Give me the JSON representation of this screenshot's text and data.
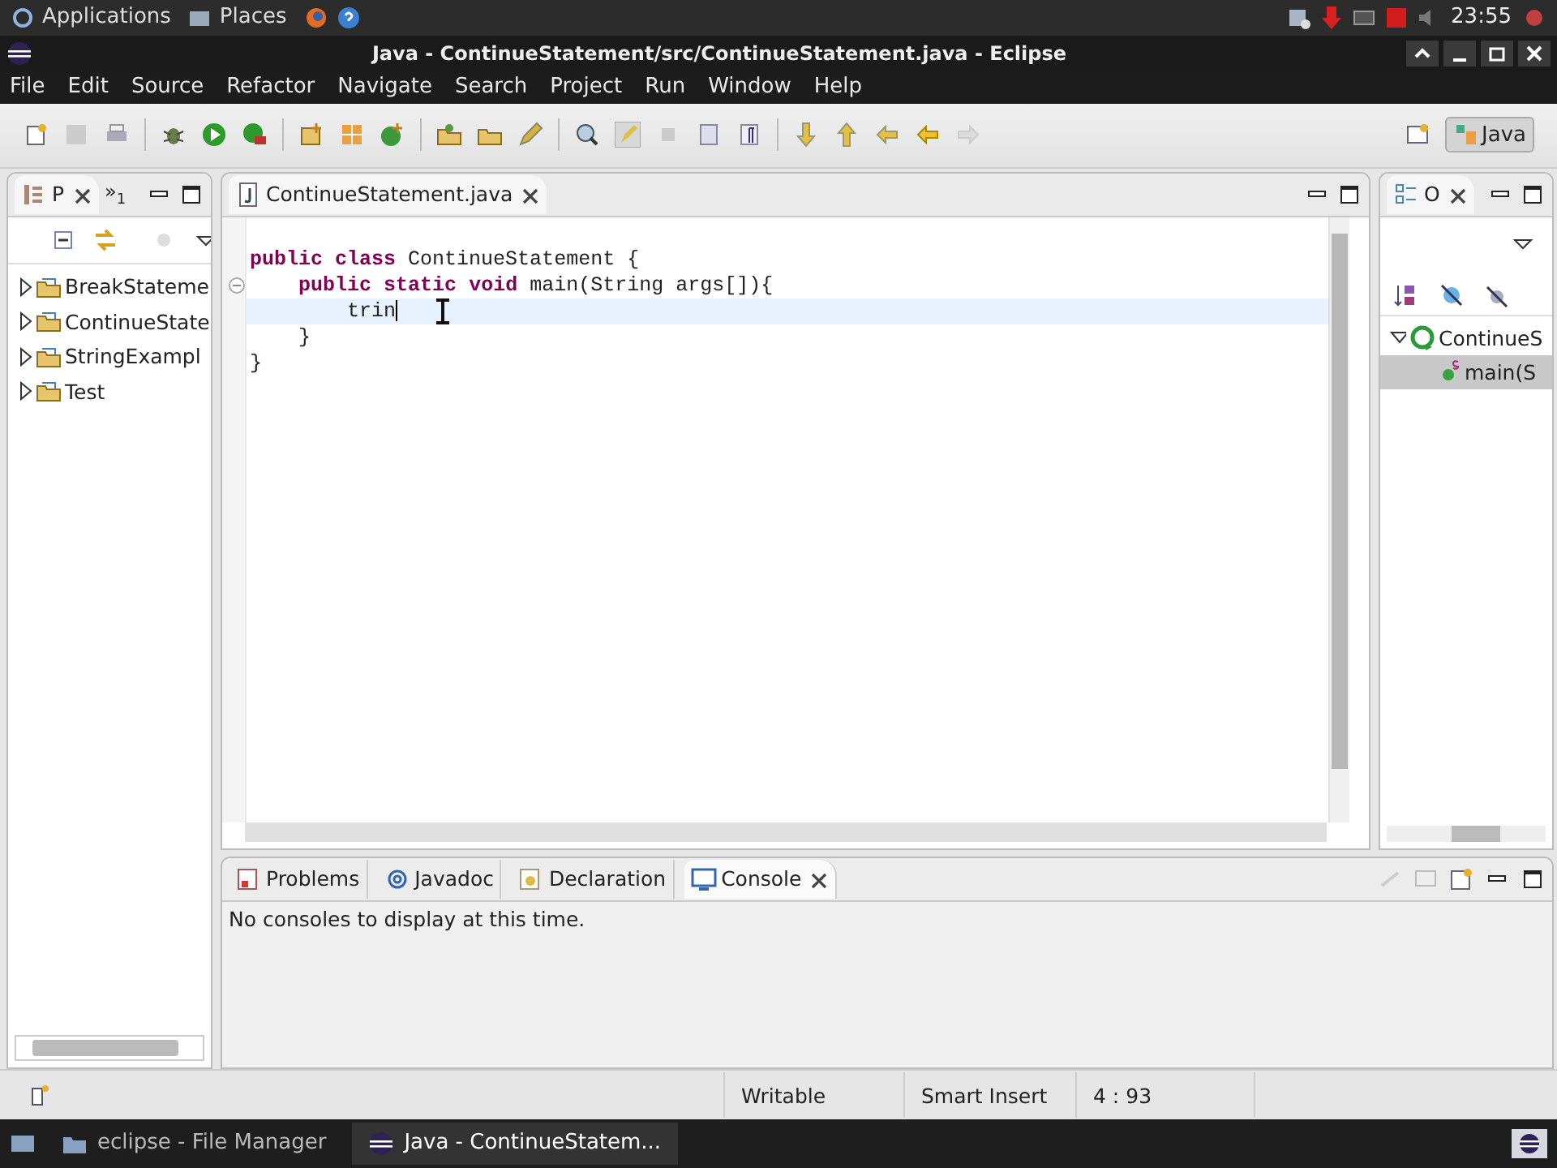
{
  "top_panel": {
    "menus": [
      "Applications",
      "Places"
    ],
    "clock": "23:55"
  },
  "window": {
    "title": "Java - ContinueStatement/src/ContinueStatement.java - Eclipse"
  },
  "menu_bar": [
    "File",
    "Edit",
    "Source",
    "Refactor",
    "Navigate",
    "Search",
    "Project",
    "Run",
    "Window",
    "Help"
  ],
  "toolbar": {
    "perspective": {
      "label": "Java",
      "selected": true
    }
  },
  "package_explorer": {
    "tab": {
      "label": "P",
      "selected": true
    },
    "overflow": {
      "chevron": "»",
      "count": "1"
    },
    "items": [
      {
        "label": "BreakStateme",
        "expanded": false
      },
      {
        "label": "ContinueState",
        "expanded": false
      },
      {
        "label": "StringExampl",
        "expanded": false
      },
      {
        "label": "Test",
        "expanded": false
      }
    ]
  },
  "editor": {
    "tab": {
      "label": "ContinueStatement.java",
      "selected": true
    },
    "lines": [
      {
        "text": "**public** **class** ContinueStatement {",
        "current": false
      },
      {
        "text": "    **public** **static** **void** main(String args[]){",
        "current": false,
        "fold": true
      },
      {
        "text": "        trin",
        "current": true
      },
      {
        "text": "    }",
        "current": false
      },
      {
        "text": "}",
        "current": false
      }
    ]
  },
  "outline": {
    "tab": {
      "label": "O",
      "selected": true
    },
    "tree": [
      {
        "label": "ContinueS",
        "expanded": true,
        "selected": false,
        "children": [
          {
            "label": "main(S",
            "selected": true
          }
        ]
      }
    ]
  },
  "bottom_panel": {
    "tabs": [
      {
        "label": "Problems",
        "selected": false
      },
      {
        "label": "Javadoc",
        "selected": false
      },
      {
        "label": "Declaration",
        "selected": false
      },
      {
        "label": "Console",
        "selected": true
      }
    ],
    "message": "No consoles to display at this time."
  },
  "status_bar": {
    "mode": "Writable",
    "insert": "Smart Insert",
    "position": "4 : 93"
  },
  "taskbar": [
    {
      "label": "eclipse - File Manager",
      "selected": false
    },
    {
      "label": "Java - ContinueStatem...",
      "selected": true
    }
  ]
}
